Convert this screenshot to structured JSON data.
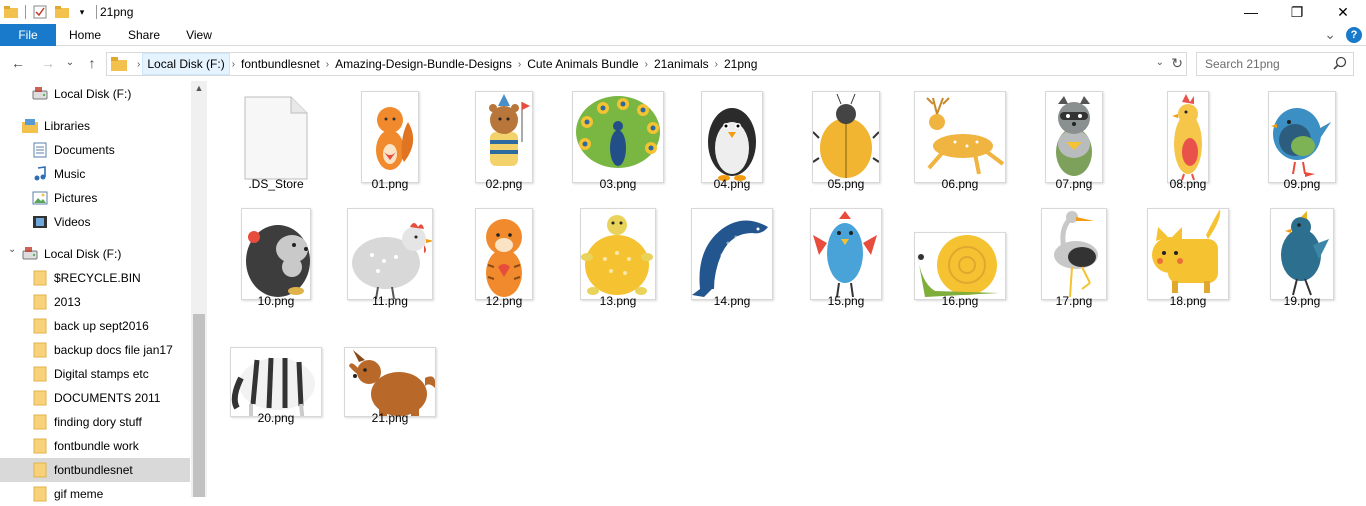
{
  "window": {
    "title": "21png",
    "minimize": "—",
    "maximize": "❐",
    "close": "✕"
  },
  "ribbon": {
    "tabs": [
      "File",
      "Home",
      "Share",
      "View"
    ],
    "expand": "⌄",
    "help": "?"
  },
  "nav": {
    "back": "←",
    "forward": "→",
    "recent": "⌄",
    "up": "↑",
    "breadcrumb": [
      "Local Disk (F:)",
      "fontbundlesnet",
      "Amazing-Design-Bundle-Designs",
      "Cute Animals Bundle",
      "21animals",
      "21png"
    ],
    "search_placeholder": "Search 21png"
  },
  "sidebar": {
    "items": [
      {
        "label": "Local Disk (F:)",
        "icon": "drive-icon"
      },
      {
        "label": "Libraries",
        "icon": "libraries-icon"
      },
      {
        "label": "Documents",
        "icon": "documents-icon"
      },
      {
        "label": "Music",
        "icon": "music-icon"
      },
      {
        "label": "Pictures",
        "icon": "pictures-icon"
      },
      {
        "label": "Videos",
        "icon": "videos-icon"
      },
      {
        "label": "Local Disk (F:)",
        "icon": "drive-icon"
      },
      {
        "label": "$RECYCLE.BIN",
        "icon": "folder-icon"
      },
      {
        "label": "2013",
        "icon": "folder-icon"
      },
      {
        "label": "back up sept2016",
        "icon": "folder-icon"
      },
      {
        "label": "backup docs file jan17",
        "icon": "folder-icon"
      },
      {
        "label": "Digital stamps etc",
        "icon": "folder-icon"
      },
      {
        "label": "DOCUMENTS 2011",
        "icon": "folder-icon"
      },
      {
        "label": "finding dory stuff",
        "icon": "folder-icon"
      },
      {
        "label": "fontbundle work",
        "icon": "folder-icon"
      },
      {
        "label": "fontbundlesnet",
        "icon": "folder-icon"
      },
      {
        "label": "gif meme",
        "icon": "folder-icon"
      }
    ]
  },
  "files": [
    {
      "name": ".DS_Store",
      "kind": "blank",
      "color": "#ffffff"
    },
    {
      "name": "01.png",
      "kind": "squirrel",
      "color": "#f08a2c"
    },
    {
      "name": "02.png",
      "kind": "bear",
      "color": "#b8763a"
    },
    {
      "name": "03.png",
      "kind": "peacock",
      "color": "#7ab642"
    },
    {
      "name": "04.png",
      "kind": "penguin",
      "color": "#2b2b2b"
    },
    {
      "name": "05.png",
      "kind": "beetle",
      "color": "#f2b531"
    },
    {
      "name": "06.png",
      "kind": "deer",
      "color": "#f0b441"
    },
    {
      "name": "07.png",
      "kind": "raccoon",
      "color": "#8a8f8f"
    },
    {
      "name": "08.png",
      "kind": "bird",
      "color": "#f5c64a"
    },
    {
      "name": "09.png",
      "kind": "bluebird",
      "color": "#3b8fc2"
    },
    {
      "name": "10.png",
      "kind": "hedgehog",
      "color": "#3d3d3d"
    },
    {
      "name": "11.png",
      "kind": "hen",
      "color": "#d8d8d8"
    },
    {
      "name": "12.png",
      "kind": "tiger",
      "color": "#f08a2c"
    },
    {
      "name": "13.png",
      "kind": "turtle",
      "color": "#f5c231"
    },
    {
      "name": "14.png",
      "kind": "dolphin",
      "color": "#23558f"
    },
    {
      "name": "15.png",
      "kind": "bird2",
      "color": "#4aa3d8"
    },
    {
      "name": "16.png",
      "kind": "snail",
      "color": "#f5c231"
    },
    {
      "name": "17.png",
      "kind": "stork",
      "color": "#c8c8c8"
    },
    {
      "name": "18.png",
      "kind": "cat",
      "color": "#f5c231"
    },
    {
      "name": "19.png",
      "kind": "bird3",
      "color": "#2d6f8f"
    },
    {
      "name": "20.png",
      "kind": "zebra",
      "color": "#333333"
    },
    {
      "name": "21.png",
      "kind": "dog",
      "color": "#b8692a"
    }
  ]
}
